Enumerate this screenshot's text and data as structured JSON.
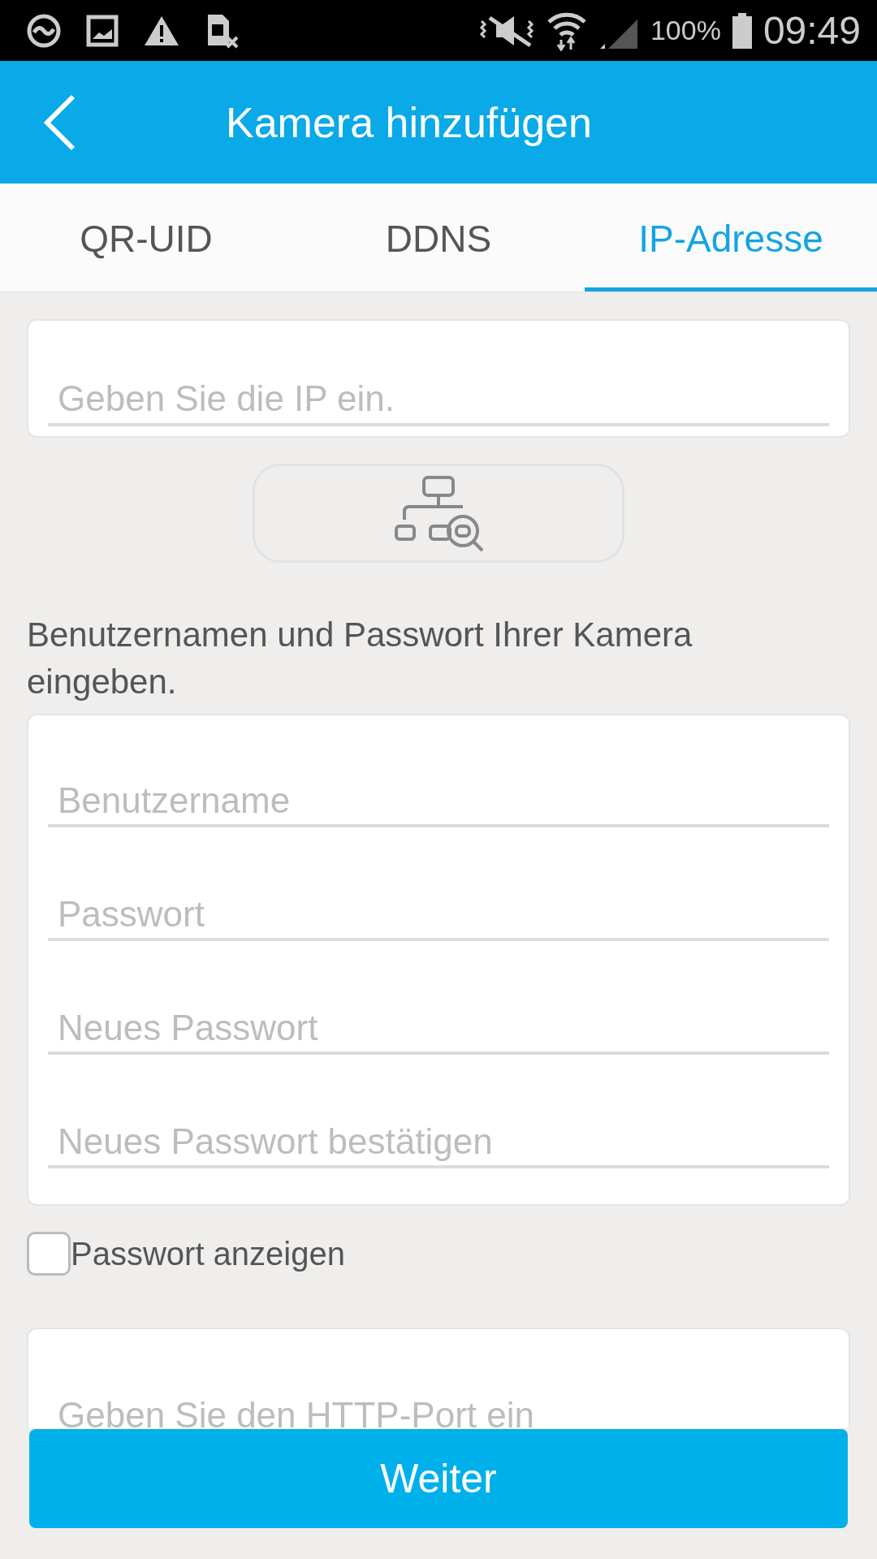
{
  "status_bar": {
    "battery_text": "100%",
    "time": "09:49"
  },
  "header": {
    "title": "Kamera hinzufügen"
  },
  "tabs": [
    {
      "label": "QR-UID",
      "selected": false
    },
    {
      "label": "DDNS",
      "selected": false
    },
    {
      "label": "IP-Adresse",
      "selected": true
    }
  ],
  "ip_field": {
    "placeholder": "Geben Sie die IP ein."
  },
  "credentials": {
    "hint": "Benutzernamen und Passwort Ihrer Kamera eingeben.",
    "fields": [
      {
        "placeholder": "Benutzername"
      },
      {
        "placeholder": "Passwort"
      },
      {
        "placeholder": "Neues Passwort"
      },
      {
        "placeholder": "Neues Passwort bestätigen"
      }
    ]
  },
  "show_password": {
    "label": "Passwort anzeigen",
    "checked": false
  },
  "port_field": {
    "placeholder": "Geben Sie den HTTP-Port ein"
  },
  "next_button": {
    "label": "Weiter"
  }
}
